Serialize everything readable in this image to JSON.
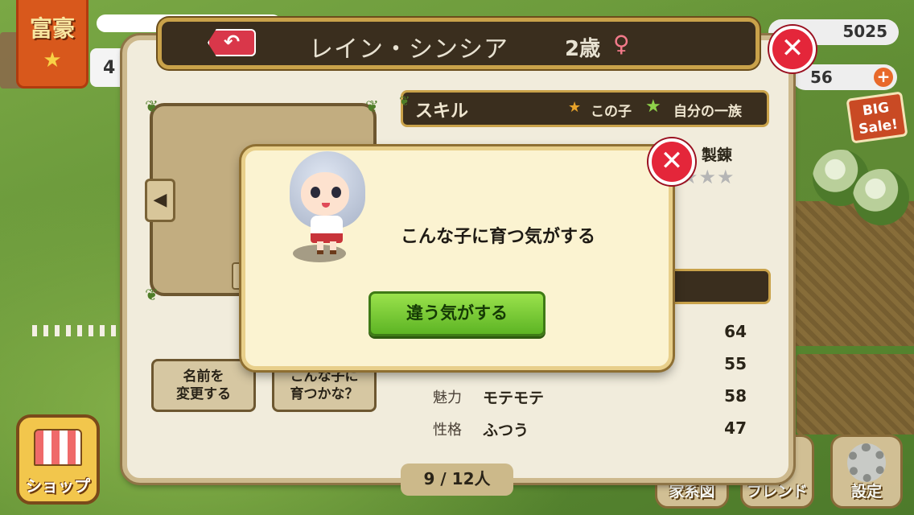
{
  "hud": {
    "banner": "富豪",
    "level": "4",
    "money": "5025",
    "medals": "56",
    "plus": "+",
    "big_sale": "BIG Sale!",
    "shop_label": "ショップ",
    "family_tree_label": "家系図",
    "friend_label": "フレンド",
    "settings_label": "設定"
  },
  "header": {
    "back_symbol": "↶",
    "name": "レイン・シンシア",
    "age": "2歳",
    "gender": "♀",
    "close": "✕"
  },
  "skills": {
    "title": "スキル",
    "legend_this_child": "この子",
    "legend_family": "自分の一族",
    "visible_skill": "製錬",
    "stars": "★★★"
  },
  "stats": [
    {
      "label": "",
      "desc": "",
      "value": "64"
    },
    {
      "label": "",
      "desc": "",
      "value": "55"
    },
    {
      "label": "魅力",
      "desc": "モテモテ",
      "value": "58"
    },
    {
      "label": "性格",
      "desc": "ふつう",
      "value": "47"
    }
  ],
  "buttons": {
    "rename": "名前を\n変更する",
    "how_grow": "こんな子に\n育つかな？"
  },
  "pager": "9 / 12人",
  "modal": {
    "message": "こんな子に育つ気がする",
    "button": "違う気がする",
    "close": "✕"
  },
  "colors": {
    "panel_bg": "#f1ecdc",
    "header_bg": "#3a2e1e",
    "gold_border": "#c9a24a",
    "close_red": "#e4263a",
    "green_button": "#5db424"
  }
}
